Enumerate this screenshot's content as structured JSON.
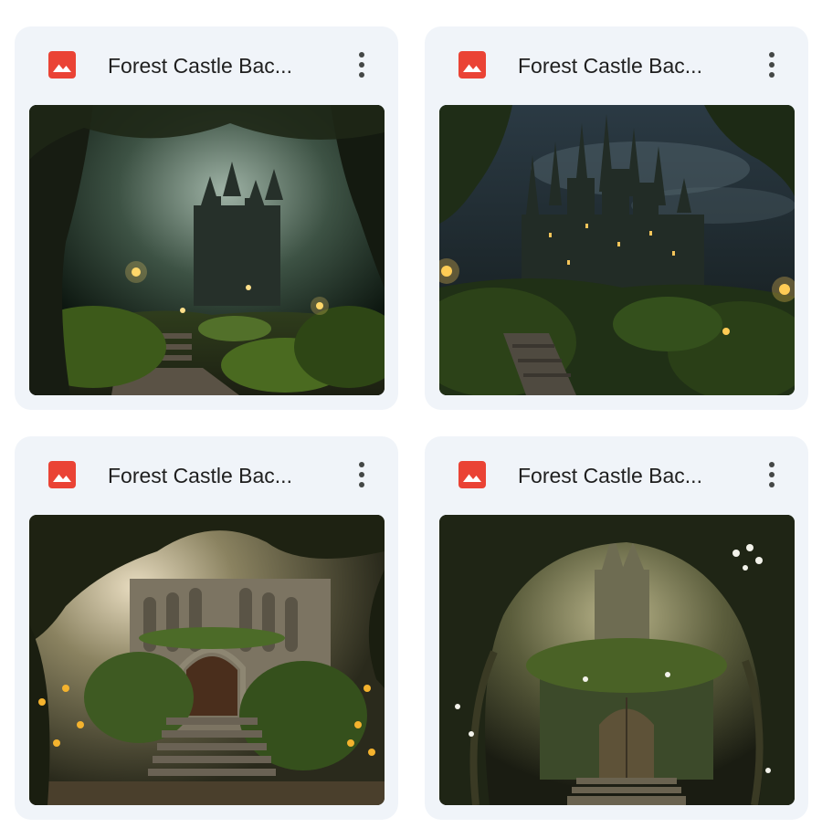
{
  "files": [
    {
      "name": "Forest Castle Bac...",
      "icon": "image-file-icon",
      "thumbnail": "forest-castle-thumbnail-1"
    },
    {
      "name": "Forest Castle Bac...",
      "icon": "image-file-icon",
      "thumbnail": "forest-castle-thumbnail-2"
    },
    {
      "name": "Forest Castle Bac...",
      "icon": "image-file-icon",
      "thumbnail": "forest-castle-thumbnail-3"
    },
    {
      "name": "Forest Castle Bac...",
      "icon": "image-file-icon",
      "thumbnail": "forest-castle-thumbnail-4"
    }
  ],
  "colors": {
    "card_background": "#f0f4f9",
    "image_icon": "#ea4335",
    "text": "#1f1f1f",
    "more_icon": "#444746"
  }
}
